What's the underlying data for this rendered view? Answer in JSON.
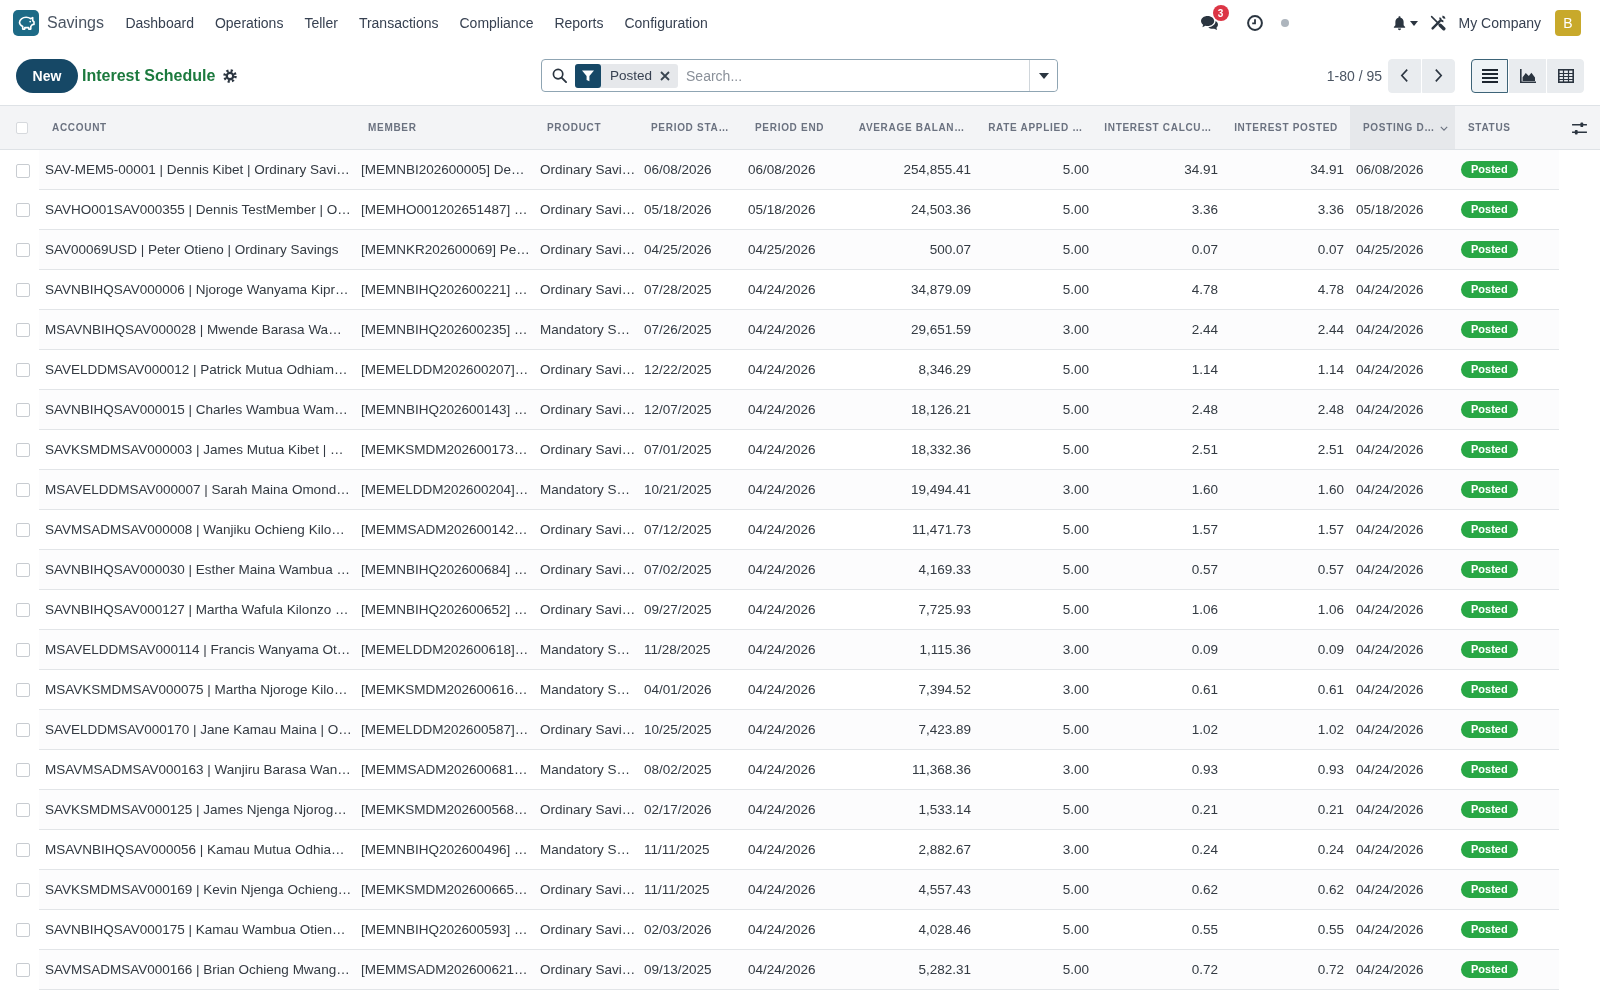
{
  "navbar": {
    "app_name": "Savings",
    "menu": [
      "Dashboard",
      "Operations",
      "Teller",
      "Transactions",
      "Compliance",
      "Reports",
      "Configuration"
    ],
    "chat_count": "3",
    "company": "My Company",
    "avatar_initial": "B"
  },
  "control_panel": {
    "new_button": "New",
    "title": "Interest Schedule",
    "search": {
      "facets": [
        {
          "label": "Posted"
        }
      ],
      "placeholder": "Search..."
    },
    "pager": "1-80 / 95",
    "views": [
      {
        "kind": "list",
        "selected": true
      },
      {
        "kind": "graph",
        "selected": false
      },
      {
        "kind": "pivot",
        "selected": false
      }
    ]
  },
  "table": {
    "select_all": false,
    "columns": [
      {
        "label": "ACCOUNT",
        "kind": "text",
        "sorted": false
      },
      {
        "label": "MEMBER",
        "kind": "text",
        "sorted": false
      },
      {
        "label": "PRODUCT",
        "kind": "text",
        "sorted": false
      },
      {
        "label": "PERIOD STA…",
        "kind": "date",
        "sorted": false
      },
      {
        "label": "PERIOD END",
        "kind": "date",
        "sorted": false
      },
      {
        "label": "AVERAGE BALAN…",
        "kind": "number",
        "sorted": false
      },
      {
        "label": "RATE APPLIED …",
        "kind": "number",
        "sorted": false
      },
      {
        "label": "INTEREST CALCU…",
        "kind": "number",
        "sorted": false
      },
      {
        "label": "INTEREST POSTED",
        "kind": "number",
        "sorted": false
      },
      {
        "label": "POSTING D…",
        "kind": "date",
        "sorted": true
      },
      {
        "label": "STATUS",
        "kind": "status",
        "sorted": false
      }
    ],
    "rows": [
      {
        "selected": false,
        "cells": [
          "SAV-MEM5-00001 | Dennis Kibet | Ordinary Savi…",
          "[MEMNBI202600005] De…",
          "Ordinary Savi…",
          "06/08/2026",
          "06/08/2026",
          "254,855.41",
          "5.00",
          "34.91",
          "34.91",
          "06/08/2026",
          "Posted"
        ]
      },
      {
        "selected": false,
        "cells": [
          "SAVHO001SAV000355 | Dennis TestMember | O…",
          "[MEMHO001202651487] …",
          "Ordinary Savi…",
          "05/18/2026",
          "05/18/2026",
          "24,503.36",
          "5.00",
          "3.36",
          "3.36",
          "05/18/2026",
          "Posted"
        ]
      },
      {
        "selected": false,
        "cells": [
          "SAV00069USD | Peter Otieno | Ordinary Savings",
          "[MEMNKR202600069] Pe…",
          "Ordinary Savi…",
          "04/25/2026",
          "04/25/2026",
          "500.07",
          "5.00",
          "0.07",
          "0.07",
          "04/25/2026",
          "Posted"
        ]
      },
      {
        "selected": false,
        "cells": [
          "SAVNBIHQSAV000006 | Njoroge Wanyama Kipr…",
          "[MEMNBIHQ202600221] …",
          "Ordinary Savi…",
          "07/28/2025",
          "04/24/2026",
          "34,879.09",
          "5.00",
          "4.78",
          "4.78",
          "04/24/2026",
          "Posted"
        ]
      },
      {
        "selected": false,
        "cells": [
          "MSAVNBIHQSAV000028 | Mwende Barasa Wa…",
          "[MEMNBIHQ202600235] …",
          "Mandatory S…",
          "07/26/2025",
          "04/24/2026",
          "29,651.59",
          "3.00",
          "2.44",
          "2.44",
          "04/24/2026",
          "Posted"
        ]
      },
      {
        "selected": false,
        "cells": [
          "SAVELDDMSAV000012 | Patrick Mutua Odhiam…",
          "[MEMELDDM202600207]…",
          "Ordinary Savi…",
          "12/22/2025",
          "04/24/2026",
          "8,346.29",
          "5.00",
          "1.14",
          "1.14",
          "04/24/2026",
          "Posted"
        ]
      },
      {
        "selected": false,
        "cells": [
          "SAVNBIHQSAV000015 | Charles Wambua Wam…",
          "[MEMNBIHQ202600143] …",
          "Ordinary Savi…",
          "12/07/2025",
          "04/24/2026",
          "18,126.21",
          "5.00",
          "2.48",
          "2.48",
          "04/24/2026",
          "Posted"
        ]
      },
      {
        "selected": false,
        "cells": [
          "SAVKSMDMSAV000003 | James Mutua Kibet | …",
          "[MEMKSMDM202600173…",
          "Ordinary Savi…",
          "07/01/2025",
          "04/24/2026",
          "18,332.36",
          "5.00",
          "2.51",
          "2.51",
          "04/24/2026",
          "Posted"
        ]
      },
      {
        "selected": false,
        "cells": [
          "MSAVELDDMSAV000007 | Sarah Maina Omond…",
          "[MEMELDDM202600204]…",
          "Mandatory S…",
          "10/21/2025",
          "04/24/2026",
          "19,494.41",
          "3.00",
          "1.60",
          "1.60",
          "04/24/2026",
          "Posted"
        ]
      },
      {
        "selected": false,
        "cells": [
          "SAVMSADMSAV000008 | Wanjiku Ochieng Kilo…",
          "[MEMMSADM202600142…",
          "Ordinary Savi…",
          "07/12/2025",
          "04/24/2026",
          "11,471.73",
          "5.00",
          "1.57",
          "1.57",
          "04/24/2026",
          "Posted"
        ]
      },
      {
        "selected": false,
        "cells": [
          "SAVNBIHQSAV000030 | Esther Maina Wambua …",
          "[MEMNBIHQ202600684] …",
          "Ordinary Savi…",
          "07/02/2025",
          "04/24/2026",
          "4,169.33",
          "5.00",
          "0.57",
          "0.57",
          "04/24/2026",
          "Posted"
        ]
      },
      {
        "selected": false,
        "cells": [
          "SAVNBIHQSAV000127 | Martha Wafula Kilonzo …",
          "[MEMNBIHQ202600652] …",
          "Ordinary Savi…",
          "09/27/2025",
          "04/24/2026",
          "7,725.93",
          "5.00",
          "1.06",
          "1.06",
          "04/24/2026",
          "Posted"
        ]
      },
      {
        "selected": false,
        "cells": [
          "MSAVELDDMSAV000114 | Francis Wanyama Ot…",
          "[MEMELDDM202600618]…",
          "Mandatory S…",
          "11/28/2025",
          "04/24/2026",
          "1,115.36",
          "3.00",
          "0.09",
          "0.09",
          "04/24/2026",
          "Posted"
        ]
      },
      {
        "selected": false,
        "cells": [
          "MSAVKSMDMSAV000075 | Martha Njoroge Kilo…",
          "[MEMKSMDM202600616…",
          "Mandatory S…",
          "04/01/2026",
          "04/24/2026",
          "7,394.52",
          "3.00",
          "0.61",
          "0.61",
          "04/24/2026",
          "Posted"
        ]
      },
      {
        "selected": false,
        "cells": [
          "SAVELDDMSAV000170 | Jane Kamau Maina | O…",
          "[MEMELDDM202600587]…",
          "Ordinary Savi…",
          "10/25/2025",
          "04/24/2026",
          "7,423.89",
          "5.00",
          "1.02",
          "1.02",
          "04/24/2026",
          "Posted"
        ]
      },
      {
        "selected": false,
        "cells": [
          "MSAVMSADMSAV000163 | Wanjiru Barasa Wan…",
          "[MEMMSADM202600681…",
          "Mandatory S…",
          "08/02/2025",
          "04/24/2026",
          "11,368.36",
          "3.00",
          "0.93",
          "0.93",
          "04/24/2026",
          "Posted"
        ]
      },
      {
        "selected": false,
        "cells": [
          "SAVKSMDMSAV000125 | James Njenga Njorog…",
          "[MEMKSMDM202600568…",
          "Ordinary Savi…",
          "02/17/2026",
          "04/24/2026",
          "1,533.14",
          "5.00",
          "0.21",
          "0.21",
          "04/24/2026",
          "Posted"
        ]
      },
      {
        "selected": false,
        "cells": [
          "MSAVNBIHQSAV000056 | Kamau Mutua Odhia…",
          "[MEMNBIHQ202600496] …",
          "Mandatory S…",
          "11/11/2025",
          "04/24/2026",
          "2,882.67",
          "3.00",
          "0.24",
          "0.24",
          "04/24/2026",
          "Posted"
        ]
      },
      {
        "selected": false,
        "cells": [
          "SAVKSMDMSAV000169 | Kevin Njenga Ochieng…",
          "[MEMKSMDM202600665…",
          "Ordinary Savi…",
          "11/11/2025",
          "04/24/2026",
          "4,557.43",
          "5.00",
          "0.62",
          "0.62",
          "04/24/2026",
          "Posted"
        ]
      },
      {
        "selected": false,
        "cells": [
          "SAVNBIHQSAV000175 | Kamau Wambua Otien…",
          "[MEMNBIHQ202600593] …",
          "Ordinary Savi…",
          "02/03/2026",
          "04/24/2026",
          "4,028.46",
          "5.00",
          "0.55",
          "0.55",
          "04/24/2026",
          "Posted"
        ]
      },
      {
        "selected": false,
        "cells": [
          "SAVMSADMSAV000166 | Brian Ochieng Mwang…",
          "[MEMMSADM202600621…",
          "Ordinary Savi…",
          "09/13/2025",
          "04/24/2026",
          "5,282.31",
          "5.00",
          "0.72",
          "0.72",
          "04/24/2026",
          "Posted"
        ]
      }
    ]
  }
}
